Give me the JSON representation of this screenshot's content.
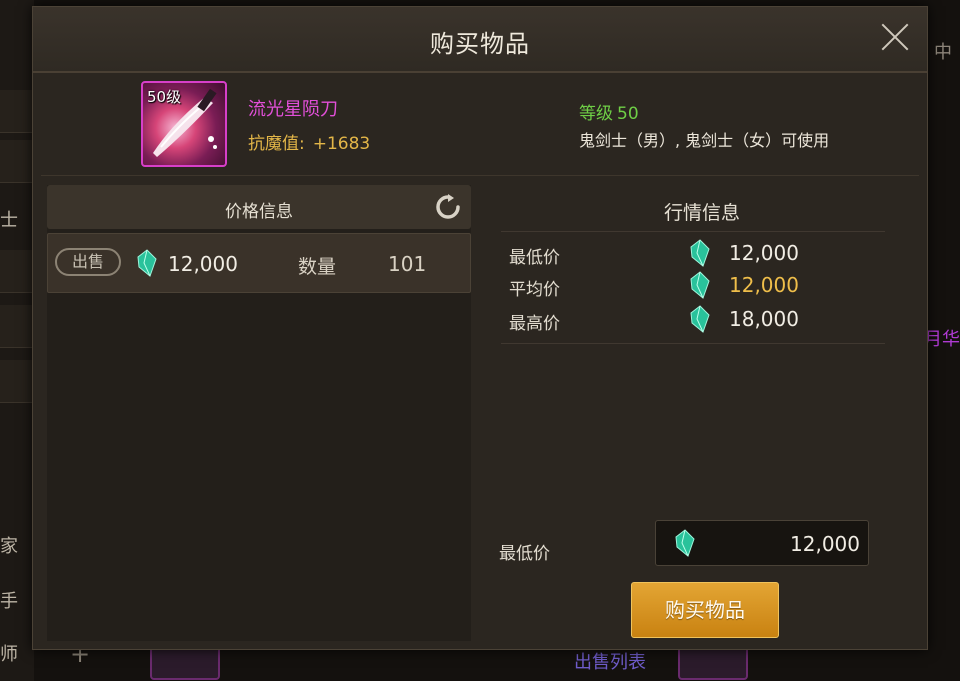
{
  "background": {
    "side_labels": [
      "士",
      "家",
      "手",
      "师"
    ],
    "right_label": "中",
    "right_purple": "月华",
    "bottom_link": "出售列表"
  },
  "dialog": {
    "title": "购买物品"
  },
  "item": {
    "level_badge": "50级",
    "name": "流光星陨刀",
    "stat_label": "抗魔值:",
    "stat_value": "+1683",
    "req_level_label": "等级",
    "req_level_value": "50",
    "classes": "鬼剑士（男）, 鬼剑士（女）可使用",
    "rarity_color": "#d73fc9"
  },
  "price_panel": {
    "title": "价格信息",
    "listings": [
      {
        "badge": "出售",
        "price": "12,000",
        "qty_label": "数量",
        "qty": "101"
      }
    ]
  },
  "market_panel": {
    "title": "行情信息",
    "rows": [
      {
        "label": "最低价",
        "value": "12,000"
      },
      {
        "label": "平均价",
        "value": "12,000"
      },
      {
        "label": "最高价",
        "value": "18,000"
      }
    ]
  },
  "purchase": {
    "min_label": "最低价",
    "min_value": "12,000",
    "buy_button": "购买物品"
  },
  "colors": {
    "gem": "#2fd0a6",
    "accent_gold": "#efbe4a",
    "button": "#d9931f"
  }
}
